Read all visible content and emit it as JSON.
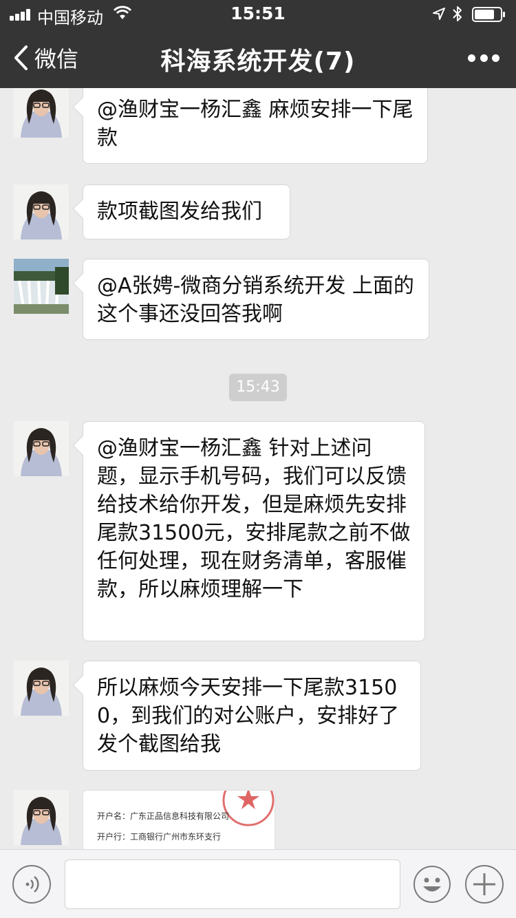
{
  "status_bar": {
    "carrier": "中国移动",
    "time": "15:51"
  },
  "nav": {
    "back_label": "微信",
    "title": "科海系统开发(7)"
  },
  "messages": [
    {
      "sender": "woman-avatar",
      "text": "@渔财宝一杨汇鑫 麻烦安排一下尾款"
    },
    {
      "sender": "woman-avatar",
      "text": "款项截图发给我们"
    },
    {
      "sender": "waterfall-avatar",
      "text": "@A张娉-微商分销系统开发 上面的这个事还没回答我啊"
    },
    {
      "sender": "woman-avatar",
      "text": "@渔财宝一杨汇鑫 针对上述问题，显示手机号码，我们可以反馈给技术给你开发，但是麻烦先安排尾款31500元，安排尾款之前不做任何处理，现在财务清单，客服催款，所以麻烦理解一下"
    },
    {
      "sender": "woman-avatar",
      "text": "所以麻烦今天安排一下尾款31500，到我们的对公账户，安排好了发个截图给我"
    }
  ],
  "time_divider": "15:43",
  "image_message": {
    "line1": "开户名：广东正品信息科技有限公司",
    "line2": "开户行：工商银行广州市东环支行"
  },
  "colors": {
    "header_bg": "#353535",
    "chat_bg": "#ebebeb",
    "bubble_bg": "#ffffff",
    "stamp_red": "#d94a4a"
  }
}
